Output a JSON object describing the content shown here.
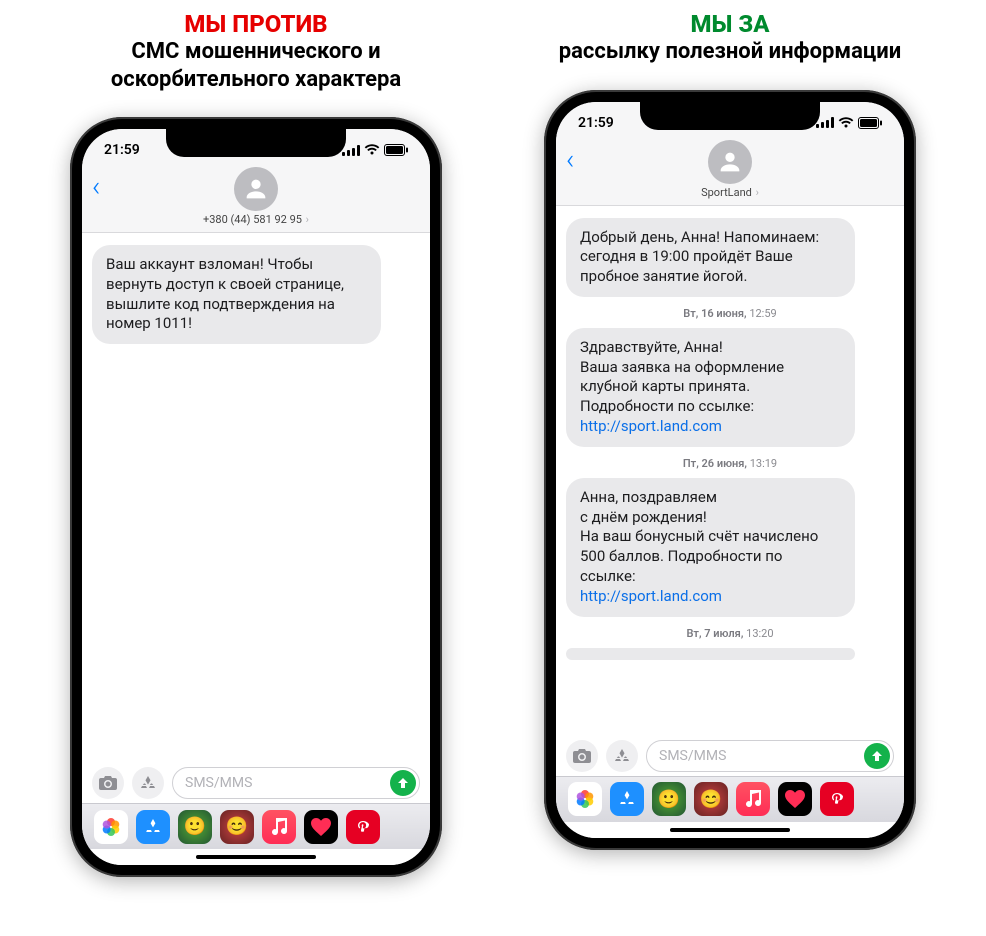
{
  "left": {
    "heading_line1": "МЫ ПРОТИВ",
    "heading_rest": "СМС мошеннического и оскорбительного характера",
    "status_time": "21:59",
    "sender": "+380 (44) 581 92 95",
    "message1": "Ваш аккаунт взломан! Чтобы вернуть доступ к своей странице, вышлите код подтверждения на номер 1011!",
    "composer_placeholder": "SMS/MMS"
  },
  "right": {
    "heading_line1": "МЫ ЗА",
    "heading_rest": "рассылку полезной информации",
    "status_time": "21:59",
    "sender": "SportLand",
    "msg1": "Добрый день, Анна! Напоминаем: сегодня в 19:00 пройдёт Ваше пробное занятие йогой.",
    "ts1_day": "Вт, 16 июня,",
    "ts1_time": "12:59",
    "msg2_text": "Здравствуйте, Анна!\nВаша заявка на оформление клубной карты принята. Подробности по ссылке:",
    "msg2_link": "http://sport.land.com",
    "ts2_day": "Пт, 26 июня,",
    "ts2_time": "13:19",
    "msg3_text": "Анна, поздравляем\nс днём рождения!\nНа ваш бонусный счёт начислено 500 баллов. Подробности по ссылке:",
    "msg3_link": "http://sport.land.com",
    "ts3_day": "Вт, 7 июля,",
    "ts3_time": "13:20",
    "composer_placeholder": "SMS/MMS"
  }
}
